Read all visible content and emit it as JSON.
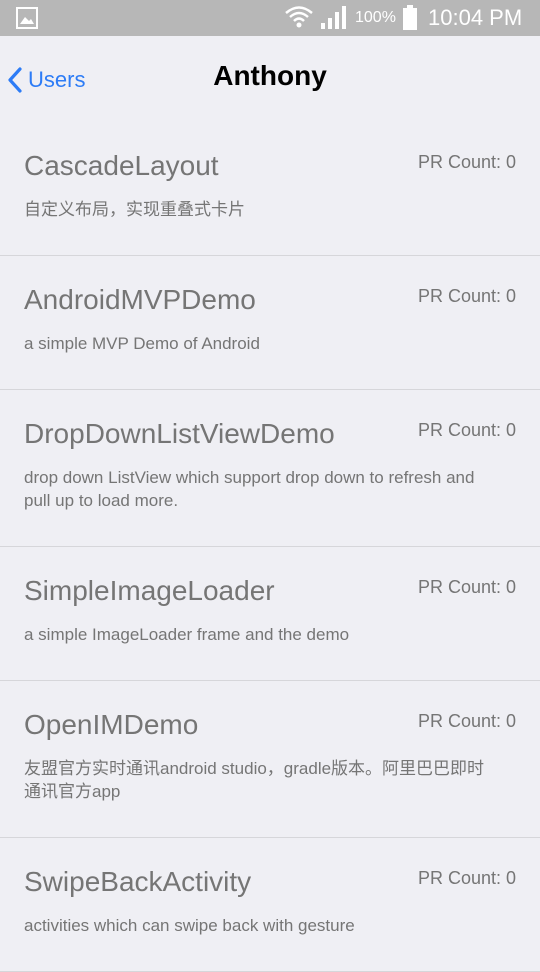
{
  "status_bar": {
    "battery_percent": "100%",
    "time": "10:04 PM",
    "icons": [
      "gallery-icon",
      "wifi-icon",
      "signal-icon",
      "battery-icon"
    ]
  },
  "nav": {
    "back_label": "Users",
    "title": "Anthony"
  },
  "colors": {
    "accent": "#2d7cf6",
    "background": "#efeff4",
    "text_secondary": "#757575",
    "status_bar": "#b7b7b7"
  },
  "repos": [
    {
      "name": "CascadeLayout",
      "pr_count": "PR Count: 0",
      "description": "自定义布局，实现重叠式卡片"
    },
    {
      "name": "AndroidMVPDemo",
      "pr_count": "PR Count: 0",
      "description": "a simple MVP Demo of Android"
    },
    {
      "name": "DropDownListViewDemo",
      "pr_count": "PR Count: 0",
      "description": "drop down ListView which support drop down to refresh and pull up to load more."
    },
    {
      "name": "SimpleImageLoader",
      "pr_count": "PR Count: 0",
      "description": "a simple ImageLoader frame and the demo"
    },
    {
      "name": "OpenIMDemo",
      "pr_count": "PR Count: 0",
      "description": "友盟官方实时通讯android studio，gradle版本。阿里巴巴即时通讯官方app"
    },
    {
      "name": "SwipeBackActivity",
      "pr_count": "PR Count: 0",
      "description": "activities which can swipe back with gesture"
    }
  ]
}
